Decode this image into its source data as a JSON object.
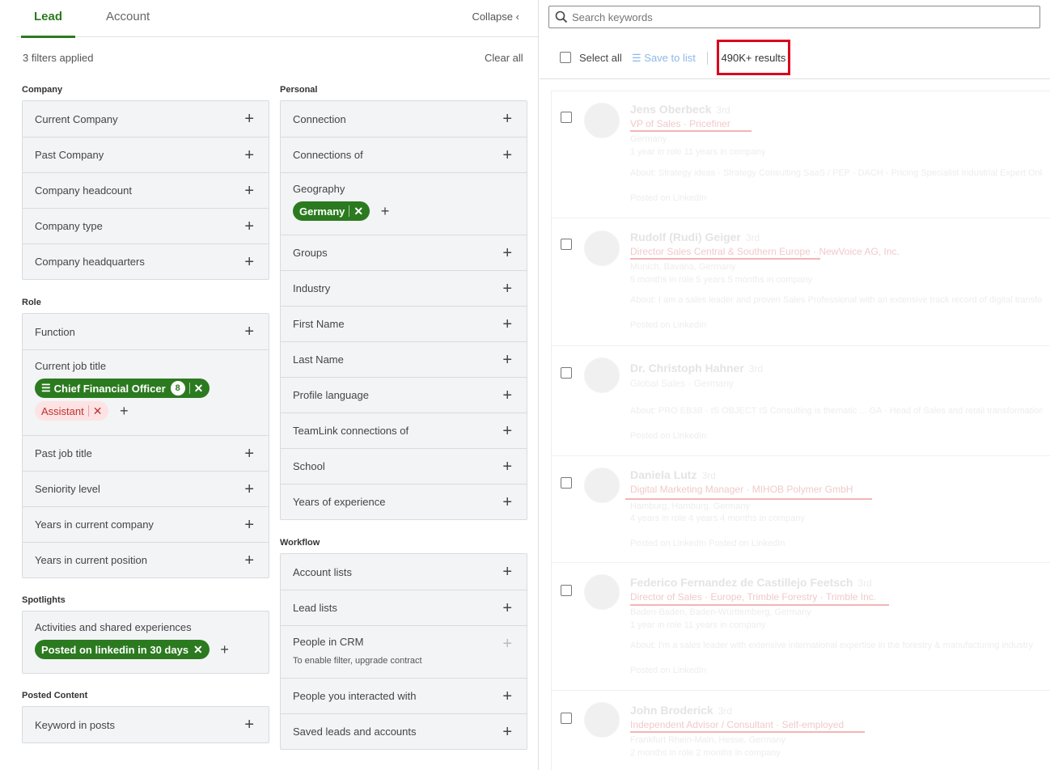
{
  "tabs": [
    "Lead",
    "Account"
  ],
  "collapse_label": "Collapse",
  "filters_applied": "3 filters applied",
  "clear_all": "Clear all",
  "company": {
    "label": "Company",
    "items": [
      "Current Company",
      "Past Company",
      "Company headcount",
      "Company type",
      "Company headquarters"
    ]
  },
  "role": {
    "label": "Role",
    "function": "Function",
    "current_job_title": {
      "label": "Current job title",
      "included_pill": "Chief Financial Officer",
      "included_count": "8",
      "excluded_pill": "Assistant"
    },
    "items_after": [
      "Past job title",
      "Seniority level",
      "Years in current company",
      "Years in current position"
    ]
  },
  "spotlights": {
    "label": "Spotlights",
    "activities": {
      "label": "Activities and shared experiences",
      "pill": "Posted on linkedin in 30 days"
    }
  },
  "posted_content": {
    "label": "Posted Content",
    "items": [
      "Keyword in posts"
    ]
  },
  "personal": {
    "label": "Personal",
    "items_before": [
      "Connection",
      "Connections of"
    ],
    "geography": {
      "label": "Geography",
      "pill": "Germany"
    },
    "items_after": [
      "Groups",
      "Industry",
      "First Name",
      "Last Name",
      "Profile language",
      "TeamLink connections of",
      "School",
      "Years of experience"
    ]
  },
  "workflow": {
    "label": "Workflow",
    "items_before": [
      "Account lists",
      "Lead lists"
    ],
    "people_in_crm": {
      "label": "People in CRM",
      "note": "To enable filter, upgrade contract"
    },
    "items_after": [
      "People you interacted with",
      "Saved leads and accounts"
    ]
  },
  "search": {
    "placeholder": "Search keywords"
  },
  "toolbar": {
    "select_all": "Select all",
    "save_to_list": "Save to list",
    "results_count": "490K+ results"
  },
  "results": [
    {
      "name": "Jens Oberbeck",
      "degree": "3rd",
      "title": "VP of Sales · Pricefiner",
      "line1": "Germany",
      "line2": "1 year in role  11 years in company",
      "line3": "About: Strategy ideas - Strategy Consulting SaaS / PEP - DACH - Pricing Specialist Industrial Expert Online",
      "line4": "Posted on LinkedIn"
    },
    {
      "name": "Rudolf (Rudi) Geiger",
      "degree": "3rd",
      "title": "Director Sales Central & Southern Europe · NewVoice AG, Inc.",
      "line1": "Munich, Bavaria, Germany",
      "line2": "5 months in role  5 years 5 months in company",
      "line3": "About: I am a sales leader and proven Sales Professional with an extensive track record of digital transformation",
      "line4": "Posted on LinkedIn"
    },
    {
      "name": "Dr. Christoph Hahner",
      "degree": "3rd",
      "title": "Global Sales · Germany",
      "line1": "",
      "line2": "",
      "line3": "About: PRO EB3B - IS OBJECT IS Consulting is thematic ... GA - Head of Sales and retail transformation",
      "line4": "Posted on LinkedIn"
    },
    {
      "name": "Daniela Lutz",
      "degree": "3rd",
      "title": "Digital Marketing Manager · MIHOB Polymer GmbH",
      "line1": "Hamburg, Hamburg, Germany",
      "line2": "4 years in role  4 years 4 months in company",
      "line3": "",
      "line4": "Posted on LinkedIn   Posted on LinkedIn"
    },
    {
      "name": "Federico Fernandez de Castillejo Feetsch",
      "degree": "3rd",
      "title": "Director of Sales · Europe, Trimble Forestry · Trimble Inc.",
      "line1": "Baden-Baden, Baden-Württemberg, Germany",
      "line2": "1 year in role  11 years in company",
      "line3": "About: I'm a sales leader with extensive international expertise in the forestry & manufacturing industry",
      "line4": "Posted on LinkedIn"
    },
    {
      "name": "John Broderick",
      "degree": "3rd",
      "title": "Independent Advisor / Consultant · Self-employed",
      "line1": "Frankfurt Rhein-Main, Hesse, Germany",
      "line2": "2 months in role  2 months in company",
      "line3": "",
      "line4": ""
    }
  ],
  "colors": {
    "accent_green": "#2b7a1f",
    "highlight_red": "#d9001b",
    "pill_red_bg": "#fde3e3"
  }
}
